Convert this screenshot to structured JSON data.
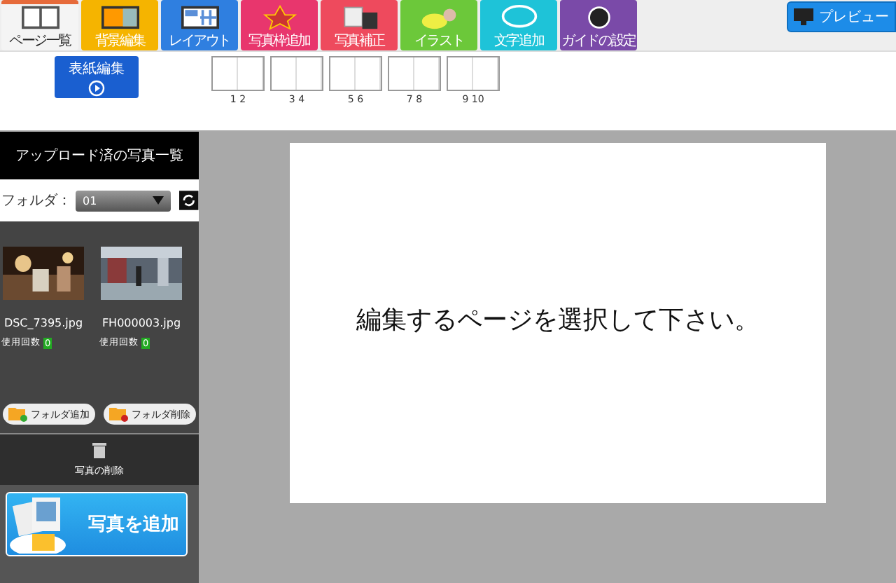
{
  "toolbar": {
    "tools": [
      {
        "label": "ページ一覧",
        "kind": "pages",
        "selected": true
      },
      {
        "label": "背景編集",
        "kind": "background",
        "selected": false
      },
      {
        "label": "レイアウト",
        "kind": "layout",
        "selected": false
      },
      {
        "label": "写真枠追加",
        "kind": "frame",
        "selected": false
      },
      {
        "label": "写真補正",
        "kind": "correct",
        "selected": false
      },
      {
        "label": "イラスト",
        "kind": "illust",
        "selected": false
      },
      {
        "label": "文字追加",
        "kind": "text",
        "selected": false
      },
      {
        "label": "ガイドの設定",
        "kind": "guide",
        "selected": false
      }
    ],
    "preview_button": "プレビュー"
  },
  "page_strip": {
    "cover_button": "表紙編集",
    "spreads": [
      {
        "label": "1 2"
      },
      {
        "label": "3 4"
      },
      {
        "label": "5 6"
      },
      {
        "label": "7 8"
      },
      {
        "label": "9 10"
      }
    ]
  },
  "photo_panel": {
    "title": "アップロード済の写真一覧",
    "folder_label": "フォルダ：",
    "folder_value": "01",
    "photos": [
      {
        "name": "DSC_7395.jpg",
        "usage_label": "使用回数",
        "usage_count": "0"
      },
      {
        "name": "FH000003.jpg",
        "usage_label": "使用回数",
        "usage_count": "0"
      }
    ],
    "add_folder": "フォルダ追加",
    "delete_folder": "フォルダ削除",
    "delete_photo": "写真の削除",
    "add_photo": "写真を追加"
  },
  "canvas": {
    "message": "編集するページを選択して下さい。"
  }
}
